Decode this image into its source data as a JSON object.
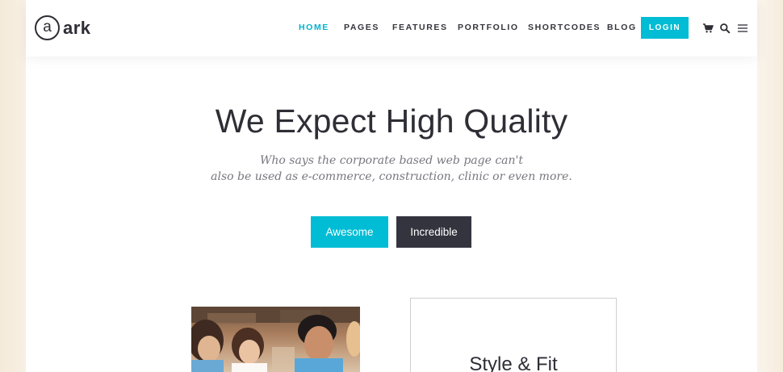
{
  "logo": {
    "mark": "a",
    "text": "ark"
  },
  "nav": {
    "items": [
      {
        "label": "HOME",
        "active": true
      },
      {
        "label": "PAGES",
        "active": false
      },
      {
        "label": "FEATURES",
        "active": false
      },
      {
        "label": "PORTFOLIO",
        "active": false
      },
      {
        "label": "SHORTCODES",
        "active": false
      },
      {
        "label": "BLOG",
        "active": false
      }
    ],
    "login_label": "LOGIN",
    "icons": [
      "cart-icon",
      "search-icon",
      "menu-icon"
    ]
  },
  "hero": {
    "title": "We Expect High Quality",
    "subtitle_line1": "Who says the corporate based web page can't",
    "subtitle_line2": "also be used as e-commerce, construction, clinic or even more.",
    "primary_button": "Awesome",
    "secondary_button": "Incredible"
  },
  "feature": {
    "title": "Style & Fit"
  },
  "colors": {
    "accent": "#00bcd4",
    "dark": "#34343f",
    "text": "#2e2e36",
    "muted": "#77777f"
  }
}
